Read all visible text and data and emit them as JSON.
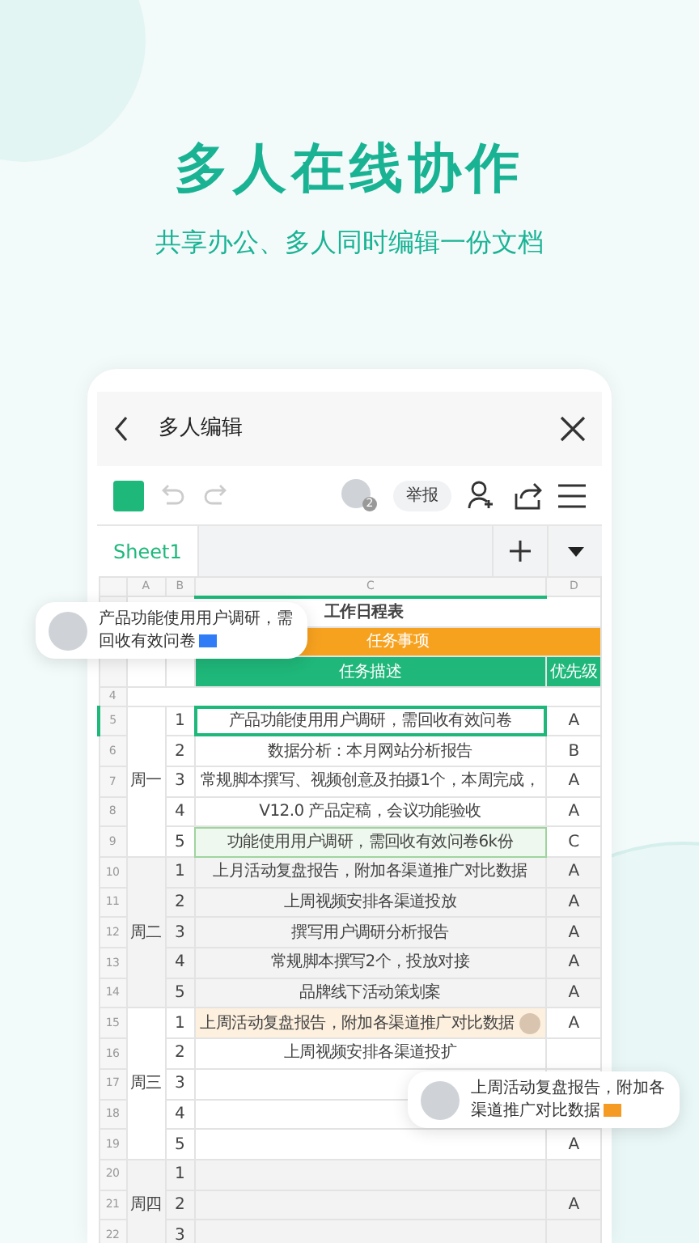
{
  "headline": "多人在线协作",
  "subheadline": "共享办公、多人同时编辑一份文档",
  "app": {
    "title": "多人编辑",
    "collaborator_count": "2",
    "report_button": "举报",
    "sheet_tabs": [
      {
        "label": "Sheet1",
        "selected": true
      }
    ],
    "columns": [
      {
        "label": "A",
        "selected": false
      },
      {
        "label": "B",
        "selected": false
      },
      {
        "label": "C",
        "selected": true
      },
      {
        "label": "D",
        "selected": false
      }
    ],
    "table_title": "工作日程表",
    "section_header": "任务事项",
    "headers": [
      "任务描述",
      "优先级"
    ],
    "blank_row": "4",
    "groups": [
      {
        "day": "周一",
        "shaded": false,
        "rows": [
          {
            "row": "5",
            "no": "1",
            "task": "产品功能使用用户调研，需回收有效问卷",
            "priority": "A",
            "kind": "selected"
          },
          {
            "row": "6",
            "no": "2",
            "task": "数据分析：本月网站分析报告",
            "priority": "B",
            "kind": "plain"
          },
          {
            "row": "7",
            "no": "3",
            "task": "常规脚本撰写、视频创意及拍摄1个，本周完成，",
            "priority": "A",
            "kind": "plain"
          },
          {
            "row": "8",
            "no": "4",
            "task": "V12.0 产品定稿，会议功能验收",
            "priority": "A",
            "kind": "plain"
          },
          {
            "row": "9",
            "no": "5",
            "task": "功能使用用户调研，需回收有效问卷6k份",
            "priority": "C",
            "kind": "edited"
          }
        ]
      },
      {
        "day": "周二",
        "shaded": true,
        "rows": [
          {
            "row": "10",
            "no": "1",
            "task": "上月活动复盘报告，附加各渠道推广对比数据",
            "priority": "A",
            "kind": "plain"
          },
          {
            "row": "11",
            "no": "2",
            "task": "上周视频安排各渠道投放",
            "priority": "A",
            "kind": "plain"
          },
          {
            "row": "12",
            "no": "3",
            "task": "撰写用户调研分析报告",
            "priority": "A",
            "kind": "plain"
          },
          {
            "row": "13",
            "no": "4",
            "task": "常规脚本撰写2个，投放对接",
            "priority": "A",
            "kind": "plain"
          },
          {
            "row": "14",
            "no": "5",
            "task": "品牌线下活动策划案",
            "priority": "A",
            "kind": "plain"
          }
        ]
      },
      {
        "day": "周三",
        "shaded": false,
        "rows": [
          {
            "row": "15",
            "no": "1",
            "task": "上周活动复盘报告，附加各渠道推广对比数据",
            "priority": "A",
            "kind": "highlight"
          },
          {
            "row": "16",
            "no": "2",
            "task": "上周视频安排各渠道投扩",
            "priority": "",
            "kind": "plain"
          },
          {
            "row": "17",
            "no": "3",
            "task": "",
            "priority": "",
            "kind": "plain"
          },
          {
            "row": "18",
            "no": "4",
            "task": "",
            "priority": "",
            "kind": "plain"
          },
          {
            "row": "19",
            "no": "5",
            "task": "",
            "priority": "A",
            "kind": "plain"
          }
        ]
      },
      {
        "day": "周四",
        "shaded": true,
        "rows": [
          {
            "row": "20",
            "no": "1",
            "task": "",
            "priority": "",
            "kind": "plain"
          },
          {
            "row": "21",
            "no": "2",
            "task": "",
            "priority": "A",
            "kind": "plain"
          },
          {
            "row": "22",
            "no": "3",
            "task": "",
            "priority": "",
            "kind": "plain"
          }
        ]
      }
    ]
  },
  "bubbles": [
    {
      "text": "产品功能使用用户调研，需回收有效问卷",
      "color": "#2f7cf6"
    },
    {
      "text": "上周活动复盘报告，附加各渠道推广对比数据",
      "color": "#f59a23"
    }
  ]
}
